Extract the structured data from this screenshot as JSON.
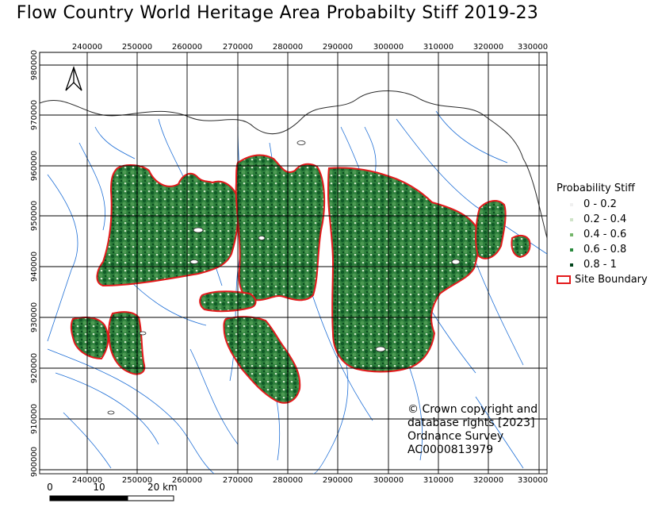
{
  "map": {
    "title": "Flow Country World Heritage Area Probabilty Stiff 2019-23",
    "x_ticks": [
      "240000",
      "250000",
      "260000",
      "270000",
      "280000",
      "290000",
      "300000",
      "310000",
      "320000",
      "330000"
    ],
    "y_ticks": [
      "980000",
      "970000",
      "960000",
      "950000",
      "940000",
      "930000",
      "920000",
      "910000",
      "900000"
    ],
    "north_arrow": "north-arrow-icon",
    "colors": {
      "boundary": "#e31a1c",
      "rivers": "#1f6fd6",
      "coast": "#2b2b2b",
      "low": "#f1f7ef",
      "mid": "#7fbf7b",
      "high": "#00441b"
    }
  },
  "legend": {
    "title": "Probability Stiff",
    "classes": [
      {
        "label": "0 - 0.2",
        "color": "#f0f0f0"
      },
      {
        "label": "0.2 - 0.4",
        "color": "#cfe3c8"
      },
      {
        "label": "0.4 - 0.6",
        "color": "#74b66a"
      },
      {
        "label": "0.6 - 0.8",
        "color": "#2a8a3e"
      },
      {
        "label": "0.8 - 1",
        "color": "#00441b"
      }
    ],
    "boundary_label": "Site Boundary"
  },
  "copyright": {
    "lines": [
      "© Crown copyright and",
      "database rights [2023]",
      "Ordnance Survey",
      "AC0000813979"
    ]
  },
  "scalebar": {
    "labels": [
      "0",
      "10",
      "20 km"
    ]
  }
}
